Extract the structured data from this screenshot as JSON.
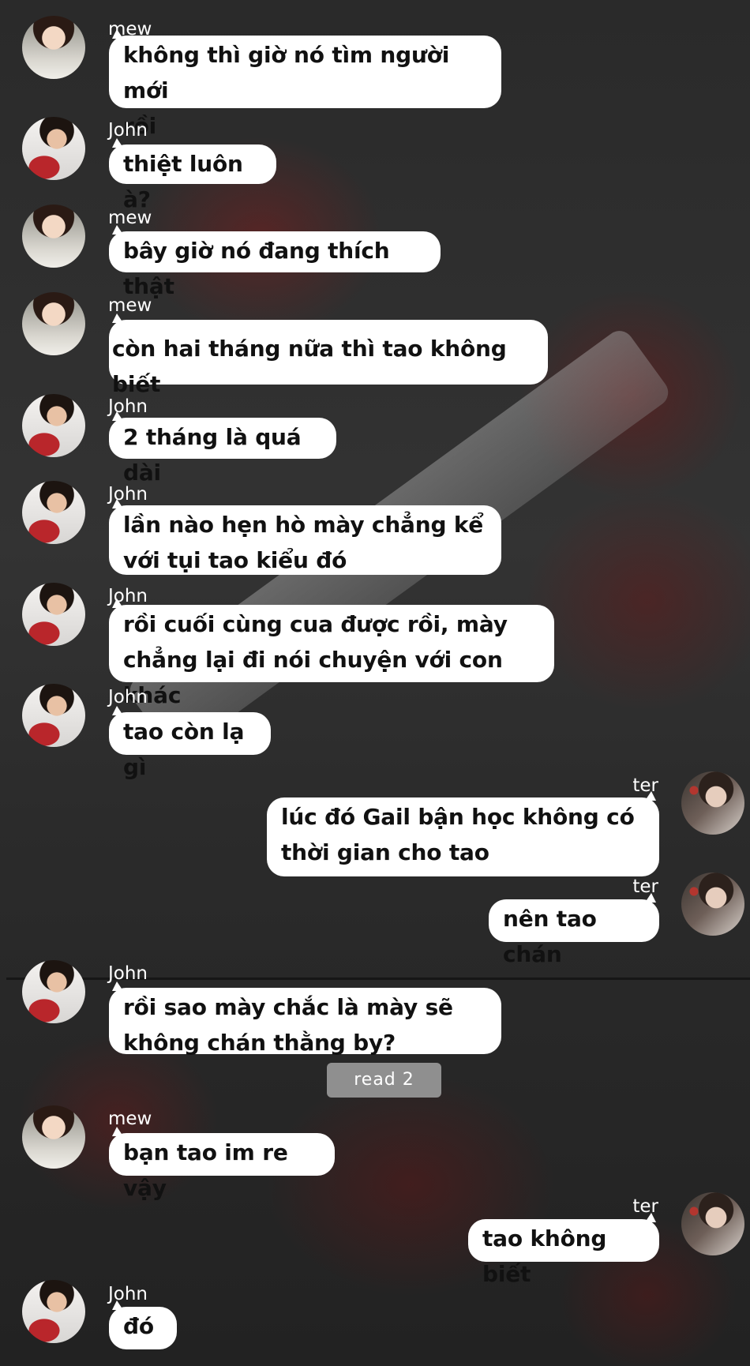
{
  "conversation": {
    "messages": [
      {
        "sender": "mew",
        "side": "left",
        "text": "không thì giờ nó tìm người mới\nrồi"
      },
      {
        "sender": "John",
        "side": "left",
        "text": "thiệt luôn à?"
      },
      {
        "sender": "mew",
        "side": "left",
        "text": "bây giờ nó đang thích thật"
      },
      {
        "sender": "mew",
        "side": "left",
        "text": "còn hai tháng nữa thì tao không biết"
      },
      {
        "sender": "John",
        "side": "left",
        "text": "2 tháng là quá dài"
      },
      {
        "sender": "John",
        "side": "left",
        "text": "lần nào hẹn hò mày chẳng kể\nvới tụi tao kiểu đó"
      },
      {
        "sender": "John",
        "side": "left",
        "text": "rồi cuối cùng cua được rồi, mày\nchẳng lại đi nói chuyện với con khác"
      },
      {
        "sender": "John",
        "side": "left",
        "text": "tao còn lạ gì"
      },
      {
        "sender": "ter",
        "side": "right",
        "text": "lúc đó Gail bận học không có\nthời gian cho tao"
      },
      {
        "sender": "ter",
        "side": "right",
        "text": "nên tao chán"
      },
      {
        "sender": "John",
        "side": "left",
        "text": "rồi sao mày chắc là mày sẽ\nkhông chán thằng by?"
      },
      {
        "sender": "mew",
        "side": "left",
        "text": "bạn tao im re vậy"
      },
      {
        "sender": "ter",
        "side": "right",
        "text": "tao không biết"
      },
      {
        "sender": "John",
        "side": "left",
        "text": "đó"
      }
    ],
    "read_status": "read 2"
  },
  "colors": {
    "bubble": "#ffffff",
    "bubble_text": "#111111",
    "name_text": "#ffffff",
    "read_badge": "#8f8f8f"
  }
}
